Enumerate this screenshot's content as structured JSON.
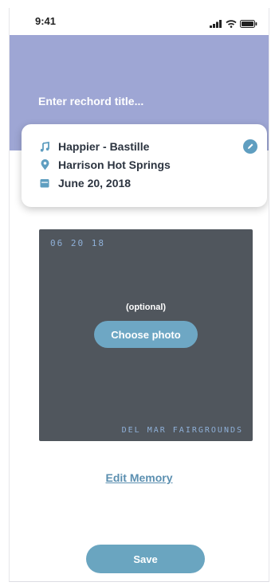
{
  "status_bar": {
    "time": "9:41",
    "icons": [
      "signal-icon",
      "wifi-icon",
      "battery-icon"
    ]
  },
  "header": {
    "title_placeholder": "Enter rechord title...",
    "background_color": "#9ea6d4"
  },
  "details_card": {
    "song": "Happier - Bastille",
    "location": "Harrison Hot Springs",
    "date": "June 20, 2018",
    "icons": [
      "music-note-icon",
      "location-pin-icon",
      "calendar-icon",
      "pencil-icon"
    ]
  },
  "photo": {
    "date_stamp": "06 20 18",
    "venue_stamp": "DEL MAR FAIRGROUNDS",
    "optional_label": "(optional)",
    "choose_label": "Choose photo"
  },
  "actions": {
    "edit_memory_label": "Edit Memory",
    "save_label": "Save",
    "accent_color": "#6aa5c0"
  }
}
